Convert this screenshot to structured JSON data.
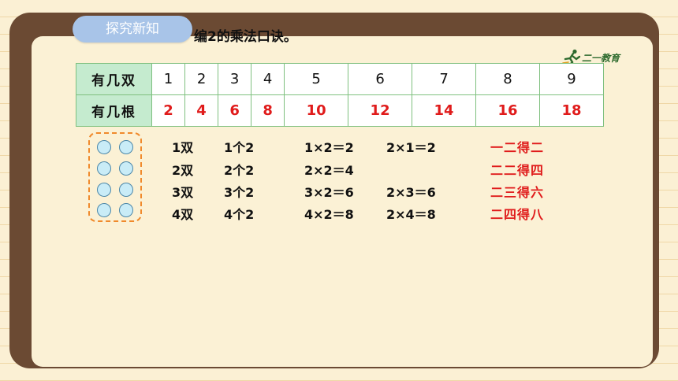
{
  "section_tag": "探究新知",
  "task_title": "编2的乘法口诀。",
  "logo_text": "二一教育",
  "table": {
    "row1_label": "有几双",
    "row2_label": "有几根",
    "pairs": [
      "1",
      "2",
      "3",
      "4",
      "5",
      "6",
      "7",
      "8",
      "9"
    ],
    "roots": [
      "2",
      "4",
      "6",
      "8",
      "10",
      "12",
      "14",
      "16",
      "18"
    ]
  },
  "dots": {
    "rows": 4,
    "per_row": 2
  },
  "work": [
    {
      "pairs": "1双",
      "groups": "1个2",
      "eq1": "1×2＝2",
      "eq2": "2×1＝2",
      "rhyme": "一二得二"
    },
    {
      "pairs": "2双",
      "groups": "2个2",
      "eq1": "2×2＝4",
      "eq2": "",
      "rhyme": "二二得四"
    },
    {
      "pairs": "3双",
      "groups": "3个2",
      "eq1": "3×2＝6",
      "eq2": "2×3＝6",
      "rhyme": "二三得六"
    },
    {
      "pairs": "4双",
      "groups": "4个2",
      "eq1": "4×2＝8",
      "eq2": "2×4＝8",
      "rhyme": "二四得八"
    }
  ],
  "colors": {
    "board": "#6b4a33",
    "tag": "#a8c4e8",
    "header_cell": "#c5ebcf",
    "highlight": "#e01b1b",
    "dot_border": "#f08a2c"
  }
}
